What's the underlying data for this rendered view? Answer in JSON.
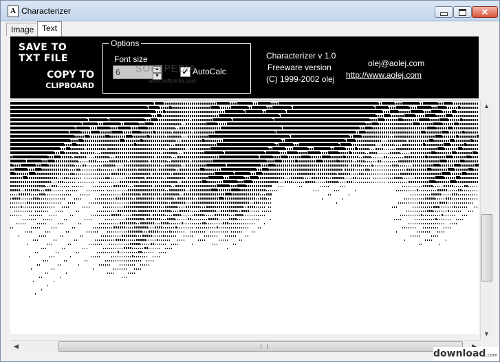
{
  "window": {
    "title": "Characterizer",
    "icon": "A"
  },
  "tabs": [
    {
      "label": "Image",
      "active": false
    },
    {
      "label": "Text",
      "active": true
    }
  ],
  "toolbar": {
    "save_line1": "Save to",
    "save_line2": "TXT File",
    "copy_line1": "Copy to",
    "copy_line2": "Clipboard",
    "options_legend": "Options",
    "font_size_label": "Font size",
    "font_size_value": "6",
    "autocalc_label": "AutoCalc",
    "autocalc_checked": true,
    "app_version": "Characterizer v 1.0",
    "freeware": "Freeware version",
    "copyright": "(C)  1999-2002  olej",
    "email": "olej@aolej.com",
    "website": "http://www.aolej.com"
  },
  "watermarks": {
    "softpedia": "SOFTPEDIA",
    "softpedia_url": "www.softpedia.com",
    "download": "download",
    "download_sub": ".com"
  },
  "colors": {
    "toolbar_bg": "#000000",
    "title_bg": "#dbe6f4",
    "close_btn": "#d9523a"
  }
}
